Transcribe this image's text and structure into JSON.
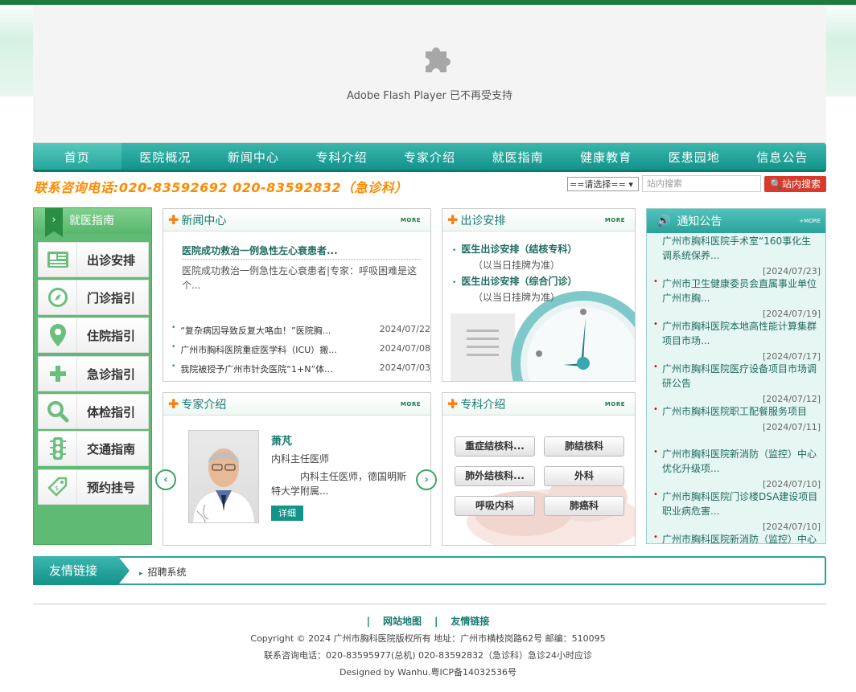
{
  "flash": {
    "message": "Adobe Flash Player 已不再受支持"
  },
  "nav": [
    "首页",
    "医院概况",
    "新闻中心",
    "专科介绍",
    "专家介绍",
    "就医指南",
    "健康教育",
    "医患园地",
    "信息公告"
  ],
  "hotline": "联系咨询电话:020-83592692   020-83592832（急诊科）",
  "search": {
    "select": "==请选择==",
    "placeholder": "站内搜索",
    "button": "站内搜索"
  },
  "sidebar": {
    "title": "就医指南",
    "items": [
      "出诊安排",
      "门诊指引",
      "住院指引",
      "急诊指引",
      "体检指引",
      "交通指南",
      "预约挂号"
    ]
  },
  "news": {
    "title": "新闻中心",
    "more": "MORE",
    "featured_title": "医院成功救治一例急性左心衰患者...",
    "featured_desc": "医院成功救治一例急性左心衰患者|专家：呼吸困难是这个...",
    "items": [
      {
        "title": "“复杂病因导致反复大咯血！”医院胸...",
        "date": "2024/07/22"
      },
      {
        "title": "广州市胸科医院重症医学科（ICU）搬...",
        "date": "2024/07/08"
      },
      {
        "title": "我院被授予广州市针灸医院“1+N”体...",
        "date": "2024/07/03"
      }
    ]
  },
  "clinic": {
    "title": "出诊安排",
    "more": "MORE",
    "items": [
      {
        "title": "医生出诊安排（结核专科）",
        "sub": "（以当日挂牌为准）"
      },
      {
        "title": "医生出诊安排（综合门诊）",
        "sub": "（以当日挂牌为准）"
      }
    ]
  },
  "notice": {
    "title": "通知公告",
    "more": "+MORE",
    "items": [
      {
        "title": "广州市胸科医院手术室“160事化生调系统保养...",
        "date": "[2024/07/23]"
      },
      {
        "title": "广州市卫生健康委员会直属事业单位广州市胸...",
        "date": "[2024/07/19]"
      },
      {
        "title": "广州市胸科医院本地高性能计算集群项目市场...",
        "date": "[2024/07/17]"
      },
      {
        "title": "广州市胸科医院医疗设备项目市场调研公告",
        "date": "[2024/07/12]"
      },
      {
        "title": "广州市胸科医院职工配餐服务项目",
        "date": "[2024/07/11]"
      },
      {
        "title": "广州市胸科医院新消防（监控）中心优化升级项...",
        "date": "[2024/07/10]"
      },
      {
        "title": "广州市胸科医院门诊楼DSA建设项目职业病危害...",
        "date": "[2024/07/10]"
      },
      {
        "title": "广州市胸科医院新消防（监控）中心",
        "date": ""
      }
    ]
  },
  "expert": {
    "title": "专家介绍",
    "more": "MORE",
    "name": "萧芃",
    "role": "内科主任医师",
    "desc": "内科主任医师，德国明斯特大学附属...",
    "detail": "详细"
  },
  "dept": {
    "title": "专科介绍",
    "more": "MORE",
    "items": [
      "重症结核科...",
      "肺结核科",
      "肺外结核科...",
      "外科",
      "呼吸内科",
      "肺癌科"
    ]
  },
  "links": {
    "title": "友情链接",
    "item": "招聘系统"
  },
  "footer": {
    "nav": [
      "网站地图",
      "友情链接"
    ],
    "copyright": "Copyright © 2024 广州市胸科医院版权所有 地址：广州市横枝岗路62号 邮编：510095",
    "contact": "联系咨询电话：020-83595977(总机)   020-83592832（急诊科）急诊24小时应诊",
    "designed": "Designed by Wanhu.粤ICP备14032536号"
  },
  "colors": {
    "teal": "#13938a",
    "green": "#5fbb73",
    "orange": "#ff8a00",
    "red": "#d63a2a"
  }
}
